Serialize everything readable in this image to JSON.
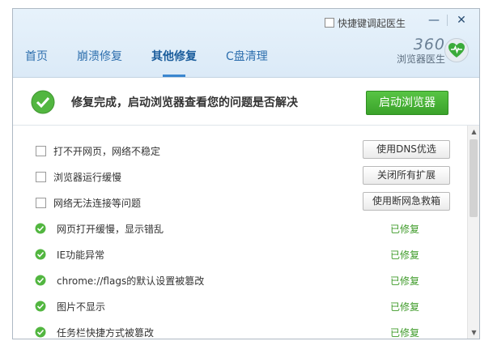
{
  "header": {
    "shortcut_label": "快捷键调起医生",
    "minimize": "—",
    "close": "✕",
    "tabs": [
      {
        "label": "首页"
      },
      {
        "label": "崩溃修复"
      },
      {
        "label": "其他修复",
        "active": true
      },
      {
        "label": "C盘清理"
      }
    ],
    "brand_number": "360",
    "brand_name": "浏览器医生"
  },
  "status": {
    "message": "修复完成，启动浏览器查看您的问题是否解决",
    "launch_button": "启动浏览器"
  },
  "issues": [
    {
      "label": "打不开网页，网络不稳定",
      "action": "使用DNS优选"
    },
    {
      "label": "浏览器运行缓慢",
      "action": "关闭所有扩展"
    },
    {
      "label": "网络无法连接等问题",
      "action": "使用断网急救箱"
    },
    {
      "label": "网页打开缓慢，显示错乱",
      "result": "已修复"
    },
    {
      "label": "IE功能异常",
      "result": "已修复"
    },
    {
      "label": "chrome://flags的默认设置被篡改",
      "result": "已修复"
    },
    {
      "label": "图片不显示",
      "result": "已修复"
    },
    {
      "label": "任务栏快捷方式被篡改",
      "result": "已修复"
    }
  ],
  "colors": {
    "accent": "#3a86cf",
    "success": "#3f9b2a",
    "launch_button": "#45b135"
  }
}
